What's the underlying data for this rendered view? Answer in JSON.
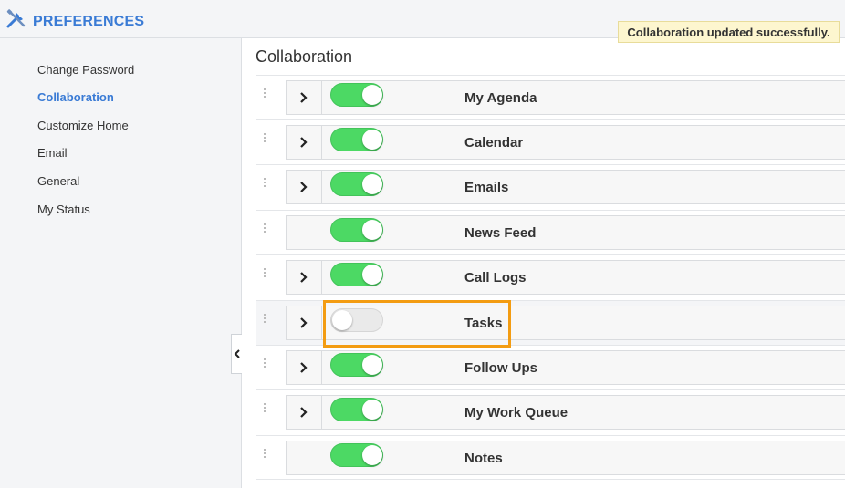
{
  "header": {
    "title": "PREFERENCES",
    "icon": "tools-icon",
    "accent_color": "#3a7bd5"
  },
  "toast": {
    "message": "Collaboration updated successfully."
  },
  "sidebar": {
    "items": [
      {
        "label": "Change Password",
        "active": false
      },
      {
        "label": "Collaboration",
        "active": true
      },
      {
        "label": "Customize Home",
        "active": false
      },
      {
        "label": "Email",
        "active": false
      },
      {
        "label": "General",
        "active": false
      },
      {
        "label": "My Status",
        "active": false
      }
    ]
  },
  "main": {
    "title": "Collaboration",
    "rows": [
      {
        "label": "My Agenda",
        "expandable": true,
        "enabled": true
      },
      {
        "label": "Calendar",
        "expandable": true,
        "enabled": true
      },
      {
        "label": "Emails",
        "expandable": true,
        "enabled": true
      },
      {
        "label": "News Feed",
        "expandable": false,
        "enabled": true
      },
      {
        "label": "Call Logs",
        "expandable": true,
        "enabled": true
      },
      {
        "label": "Tasks",
        "expandable": true,
        "enabled": false
      },
      {
        "label": "Follow Ups",
        "expandable": true,
        "enabled": true
      },
      {
        "label": "My Work Queue",
        "expandable": true,
        "enabled": true
      },
      {
        "label": "Notes",
        "expandable": false,
        "enabled": true
      }
    ]
  },
  "colors": {
    "toggle_on": "#4cd964",
    "toggle_off": "#eaeaea",
    "highlight": "#f39c12",
    "toast_bg": "#fdf6cf"
  }
}
